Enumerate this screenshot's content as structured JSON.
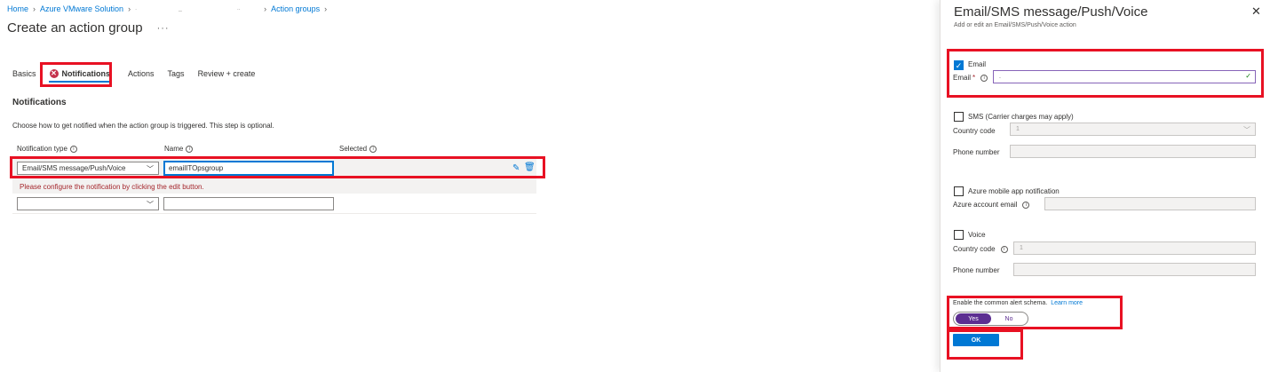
{
  "breadcrumb": {
    "home": "Home",
    "solution": "Azure VMware Solution",
    "redacted_1": ".",
    "redacted_2": "_",
    "redacted_3": "..",
    "action_groups": "Action groups"
  },
  "page": {
    "title": "Create an action group",
    "more": "···"
  },
  "tabs": [
    {
      "label": "Basics"
    },
    {
      "label": "Notifications"
    },
    {
      "label": "Actions"
    },
    {
      "label": "Tags"
    },
    {
      "label": "Review + create"
    }
  ],
  "notifications": {
    "title": "Notifications",
    "description": "Choose how to get notified when the action group is triggered. This step is optional.",
    "columns": {
      "type": "Notification type",
      "name": "Name",
      "selected": "Selected"
    },
    "row1": {
      "type": "Email/SMS message/Push/Voice",
      "name": "emailITOpsgroup"
    },
    "row_error": "Please configure the notification by clicking the edit button.",
    "row2": {
      "type": "",
      "name": ""
    }
  },
  "pane": {
    "title": "Email/SMS message/Push/Voice",
    "subtitle": "Add or edit an Email/SMS/Push/Voice action",
    "email": {
      "checkbox": "Email",
      "label": "Email",
      "required": "*",
      "value": ".",
      "checked": true
    },
    "sms": {
      "checkbox": "SMS (Carrier charges may apply)",
      "country_label": "Country code",
      "country_value": "1",
      "phone_label": "Phone number"
    },
    "push": {
      "checkbox": "Azure mobile app notification",
      "account_label": "Azure account email"
    },
    "voice": {
      "checkbox": "Voice",
      "country_label": "Country code",
      "country_value": "1",
      "phone_label": "Phone number"
    },
    "schema": {
      "label": "Enable the common alert schema.",
      "link": "Learn more",
      "yes": "Yes",
      "no": "No",
      "selected": "Yes"
    },
    "ok": "OK"
  },
  "colors": {
    "accent": "#0078d4",
    "highlight_box": "#e81123",
    "toggle_on": "#5c2e91",
    "error": "#a4262c"
  }
}
